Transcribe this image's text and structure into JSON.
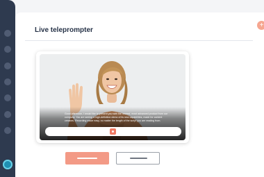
{
  "header": {
    "title": "Live teleprompter",
    "add_icon_label": "+"
  },
  "sidebar": {
    "items": [
      {
        "icon": "nav-dot-icon"
      },
      {
        "icon": "nav-dot-icon"
      },
      {
        "icon": "nav-dot-icon"
      },
      {
        "icon": "nav-dot-icon"
      },
      {
        "icon": "nav-dot-icon"
      },
      {
        "icon": "nav-dot-icon"
      },
      {
        "icon": "nav-dot-icon"
      }
    ],
    "avatar_icon": "user-avatar-icon"
  },
  "preview": {
    "script_text": "Good afternoon, I would like to present you with the newest, most advanced product from our company. You are seeing a high-definition demo of its new capabilities, made for content creators. Recording made easy, no matter the length of the script you are reading from.",
    "record_icon": "record-icon"
  },
  "colors": {
    "accent": "#f39a86",
    "rail": "#2e3a4f",
    "title": "#263247"
  }
}
